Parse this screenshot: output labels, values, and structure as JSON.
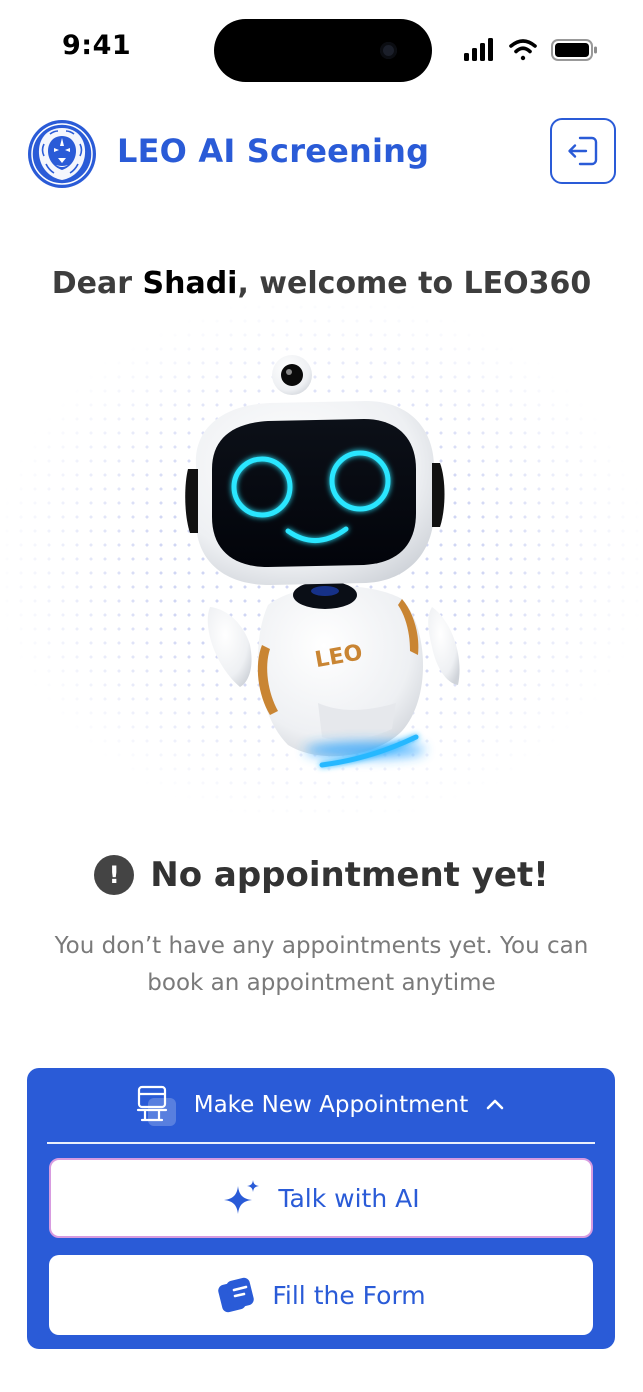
{
  "status_bar": {
    "time": "9:41"
  },
  "header": {
    "brand": "LEO AI Screening"
  },
  "welcome": {
    "prefix": "Dear ",
    "name": "Shadi",
    "suffix": ", welcome to LEO360"
  },
  "robot": {
    "chest_label": "LEO"
  },
  "empty_state": {
    "icon_glyph": "!",
    "title": "No appointment yet!",
    "description": "You don’t have any appointments yet. You can book an appointment anytime"
  },
  "appointment_menu": {
    "title": "Make New Appointment",
    "options": [
      {
        "label": "Talk with AI",
        "icon": "sparkle-icon"
      },
      {
        "label": "Fill the Form",
        "icon": "form-icon"
      }
    ]
  },
  "colors": {
    "accent": "#2a5bd7",
    "text_dark": "#333333",
    "text_muted": "#7a7a7a"
  }
}
